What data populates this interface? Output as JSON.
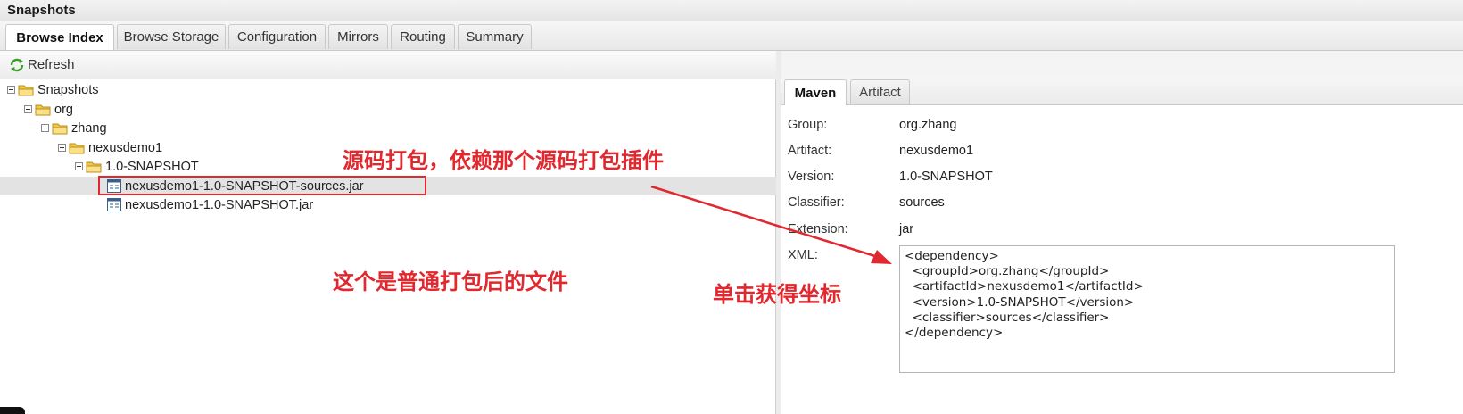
{
  "window": {
    "title": "Snapshots"
  },
  "tabs": [
    {
      "label": "Browse Index",
      "active": true
    },
    {
      "label": "Browse Storage",
      "active": false
    },
    {
      "label": "Configuration",
      "active": false
    },
    {
      "label": "Mirrors",
      "active": false
    },
    {
      "label": "Routing",
      "active": false
    },
    {
      "label": "Summary",
      "active": false
    }
  ],
  "toolbar": {
    "refresh_label": "Refresh",
    "refresh_icon": "refresh-icon"
  },
  "tree": [
    {
      "label": "Snapshots",
      "level": 0,
      "type": "folder",
      "expanded": true
    },
    {
      "label": "org",
      "level": 1,
      "type": "folder",
      "expanded": true
    },
    {
      "label": "zhang",
      "level": 2,
      "type": "folder",
      "expanded": true
    },
    {
      "label": "nexusdemo1",
      "level": 3,
      "type": "folder",
      "expanded": true
    },
    {
      "label": "1.0-SNAPSHOT",
      "level": 4,
      "type": "folder",
      "expanded": true
    },
    {
      "label": "nexusdemo1-1.0-SNAPSHOT-sources.jar",
      "level": 5,
      "type": "file",
      "selected": true
    },
    {
      "label": "nexusdemo1-1.0-SNAPSHOT.jar",
      "level": 5,
      "type": "file",
      "selected": false
    }
  ],
  "detail_tabs": [
    {
      "label": "Maven",
      "active": true
    },
    {
      "label": "Artifact",
      "active": false
    }
  ],
  "details": {
    "group_label": "Group:",
    "group_value": "org.zhang",
    "artifact_label": "Artifact:",
    "artifact_value": "nexusdemo1",
    "version_label": "Version:",
    "version_value": "1.0-SNAPSHOT",
    "classifier_label": "Classifier:",
    "classifier_value": "sources",
    "extension_label": "Extension:",
    "extension_value": "jar",
    "xml_label": "XML:",
    "xml_value": "<dependency>\n  <groupId>org.zhang</groupId>\n  <artifactId>nexusdemo1</artifactId>\n  <version>1.0-SNAPSHOT</version>\n  <classifier>sources</classifier>\n</dependency>"
  },
  "annotations": {
    "sources_note": "源码打包，依赖那个源码打包插件",
    "normal_note": "这个是普通打包后的文件",
    "coords_note": "单击获得坐标"
  },
  "colors": {
    "annotation": "#e0282e",
    "selected_row": "#e3e3e3",
    "folder": "#f5c542"
  }
}
